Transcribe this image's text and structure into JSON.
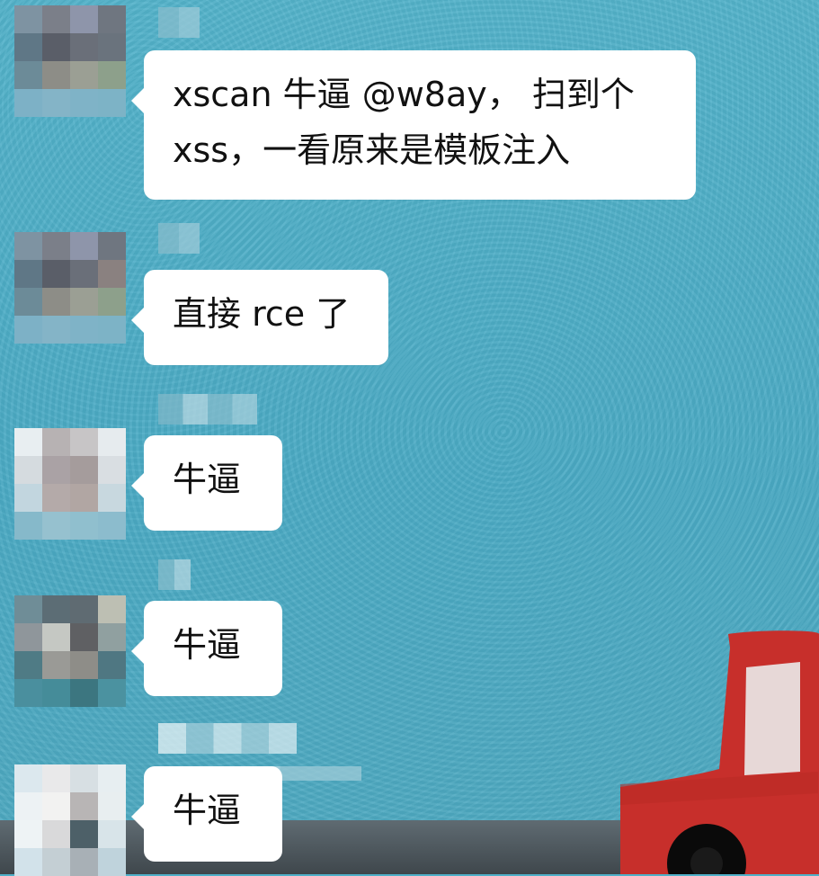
{
  "theme": {
    "background": "#4fb0c8",
    "bubble": "#ffffff",
    "text": "#111111",
    "car_red": "#c72f2b"
  },
  "chat": {
    "messages": [
      {
        "lines": [
          "xscan 牛逼 @w8ay， 扫到个",
          "xss，一看原来是模板注入"
        ]
      },
      {
        "text": "直接 rce 了"
      },
      {
        "text": "牛逼"
      },
      {
        "text": "牛逼"
      },
      {
        "text": "牛逼"
      }
    ]
  }
}
